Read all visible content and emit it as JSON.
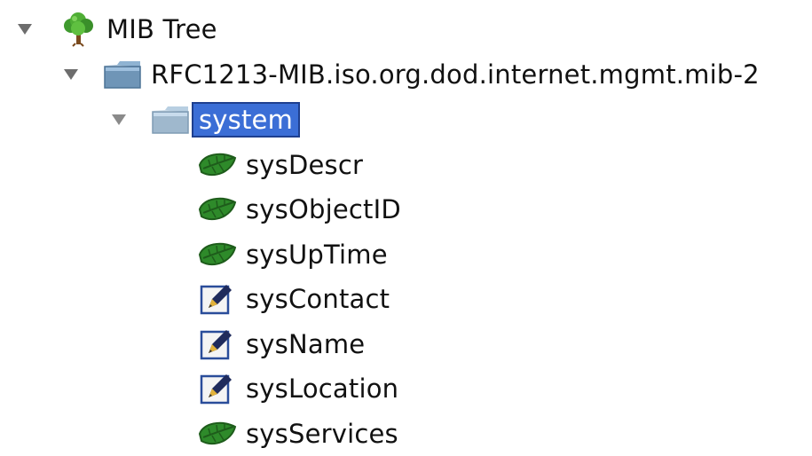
{
  "tree": {
    "root": {
      "label": "MIB Tree",
      "icon": "tree-icon",
      "expanded": true
    },
    "module": {
      "label": "RFC1213-MIB.iso.org.dod.internet.mgmt.mib-2",
      "icon": "folder-icon",
      "expanded": true
    },
    "group": {
      "label": "system",
      "icon": "folder-icon",
      "expanded": true,
      "selected": true
    },
    "nodes": [
      {
        "label": "sysDescr",
        "icon": "leaf-icon"
      },
      {
        "label": "sysObjectID",
        "icon": "leaf-icon"
      },
      {
        "label": "sysUpTime",
        "icon": "leaf-icon"
      },
      {
        "label": "sysContact",
        "icon": "pen-edit-icon"
      },
      {
        "label": "sysName",
        "icon": "pen-edit-icon"
      },
      {
        "label": "sysLocation",
        "icon": "pen-edit-icon"
      },
      {
        "label": "sysServices",
        "icon": "leaf-icon"
      }
    ]
  },
  "colors": {
    "selection": "#3b6ed6",
    "leaf_green": "#2e8a2a",
    "folder_blue": "#6f95b7"
  }
}
